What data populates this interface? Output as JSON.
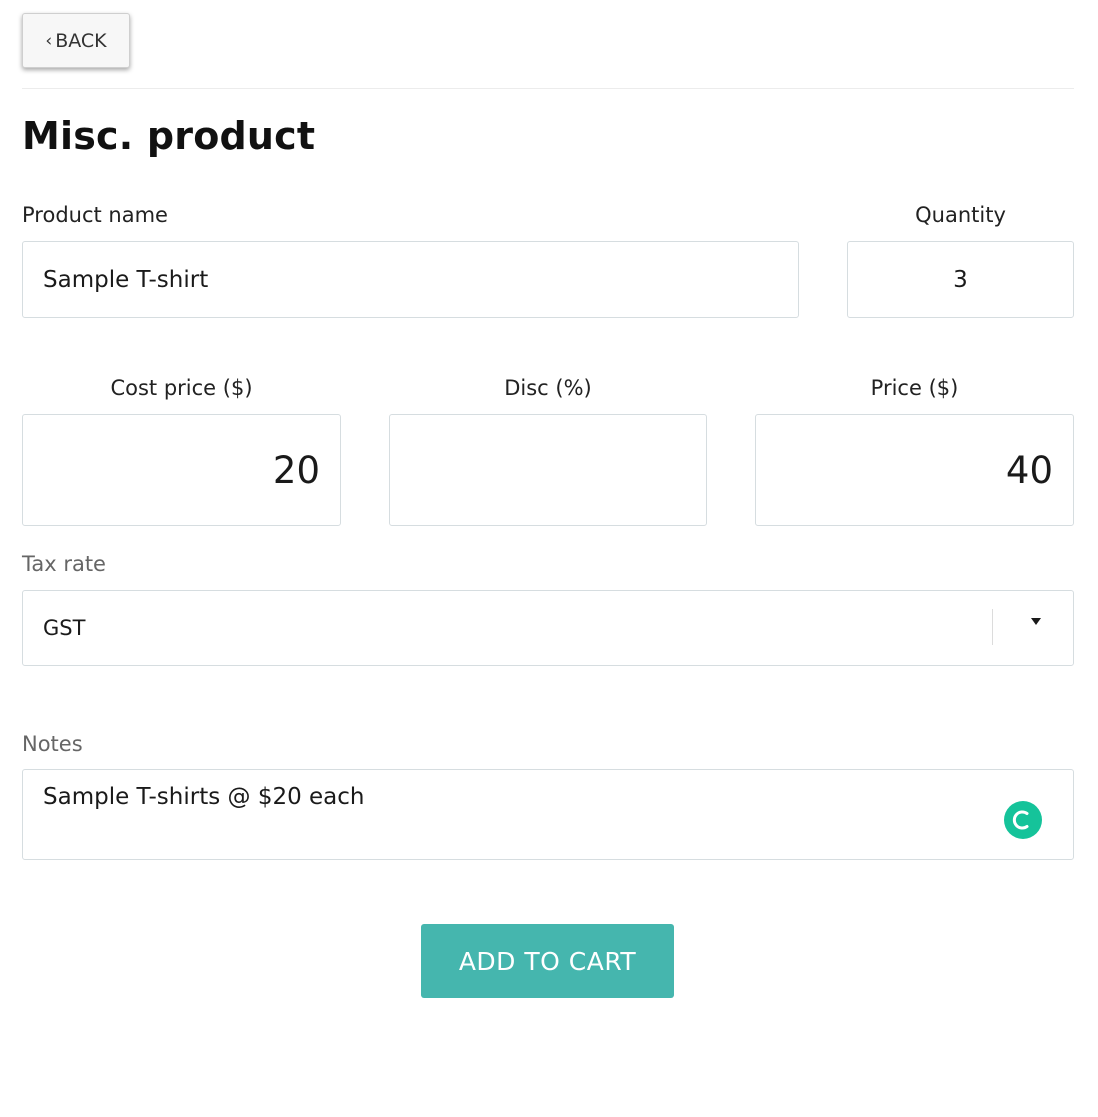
{
  "back_button": {
    "chevron": "‹",
    "label": "BACK"
  },
  "page_title": "Misc. product",
  "fields": {
    "product_name": {
      "label": "Product name",
      "value": "Sample T-shirt"
    },
    "quantity": {
      "label": "Quantity",
      "value": "3"
    },
    "cost_price": {
      "label": "Cost price ($)",
      "value": "20"
    },
    "discount": {
      "label": "Disc (%)",
      "value": ""
    },
    "price": {
      "label": "Price ($)",
      "value": "40"
    },
    "tax_rate": {
      "label": "Tax rate",
      "value": "GST",
      "icon": "dropdown-arrow-icon"
    },
    "notes": {
      "label": "Notes",
      "value": "Sample T-shirts @ $20 each",
      "icon": "grammar-check-icon"
    }
  },
  "add_to_cart": {
    "label": "ADD TO CART"
  },
  "colors": {
    "accent": "#45b6ae",
    "grammar_icon": "#15c39a",
    "border": "#d6dde0"
  }
}
